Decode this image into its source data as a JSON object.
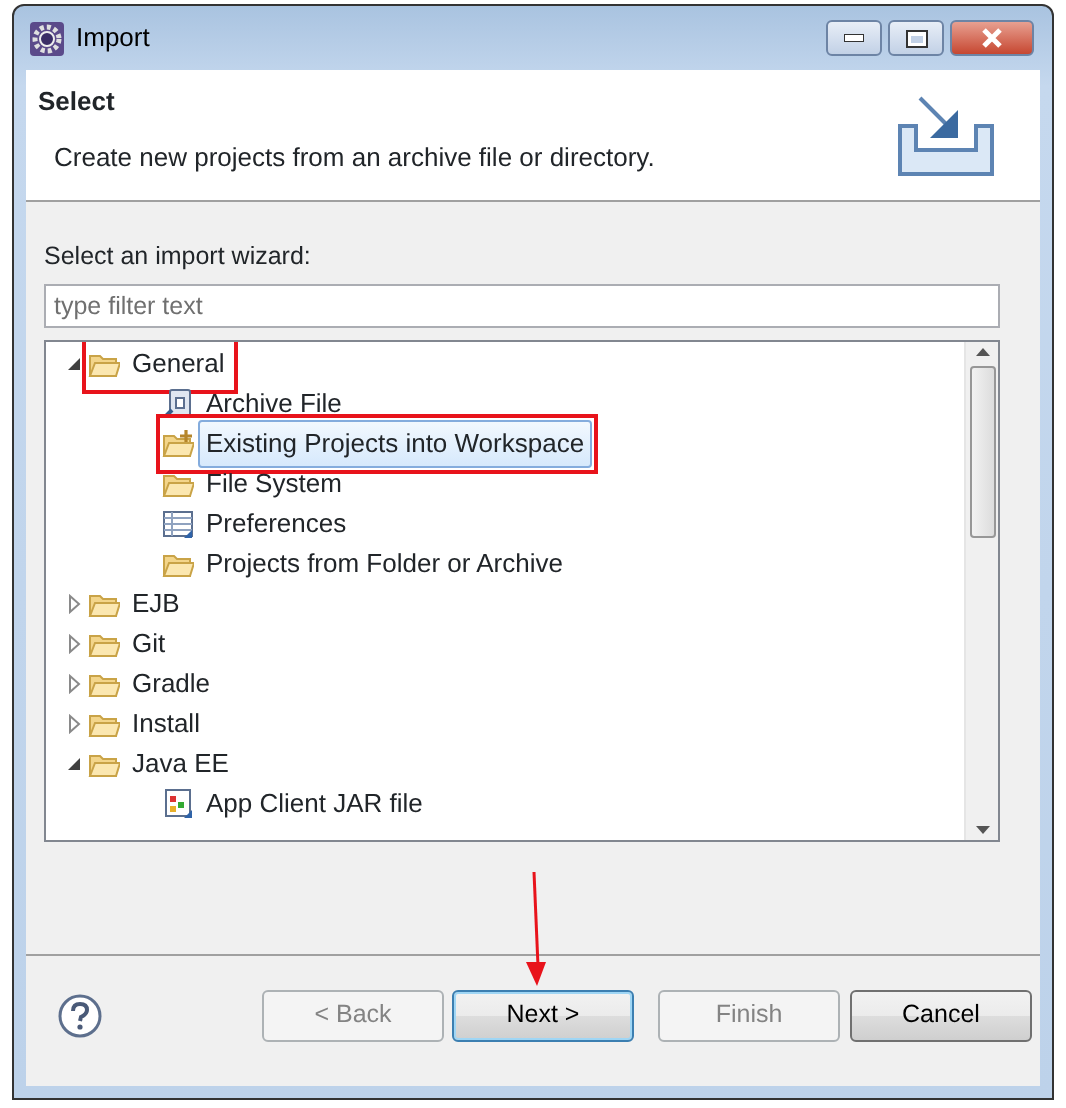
{
  "window": {
    "title": "Import"
  },
  "header": {
    "title": "Select",
    "description": "Create new projects from an archive file or directory."
  },
  "wizard_label": "Select an import wizard:",
  "filter": {
    "placeholder": "type filter text"
  },
  "tree": [
    {
      "label": "General",
      "kind": "folder",
      "expanded": true,
      "selected": false,
      "annotated": true,
      "children": [
        {
          "label": "Archive File",
          "kind": "archive",
          "selected": false
        },
        {
          "label": "Existing Projects into Workspace",
          "kind": "project",
          "selected": true,
          "annotated": true
        },
        {
          "label": "File System",
          "kind": "folder",
          "selected": false
        },
        {
          "label": "Preferences",
          "kind": "table",
          "selected": false
        },
        {
          "label": "Projects from Folder or Archive",
          "kind": "folder",
          "selected": false
        }
      ]
    },
    {
      "label": "EJB",
      "kind": "folder",
      "expanded": false,
      "selected": false
    },
    {
      "label": "Git",
      "kind": "folder",
      "expanded": false,
      "selected": false
    },
    {
      "label": "Gradle",
      "kind": "folder",
      "expanded": false,
      "selected": false
    },
    {
      "label": "Install",
      "kind": "folder",
      "expanded": false,
      "selected": false
    },
    {
      "label": "Java EE",
      "kind": "folder",
      "expanded": true,
      "selected": false,
      "children": [
        {
          "label": "App Client JAR file",
          "kind": "jar",
          "selected": false
        }
      ]
    }
  ],
  "buttons": [
    {
      "label": "< Back",
      "disabled": true,
      "default": false
    },
    {
      "label": "Next >",
      "disabled": false,
      "default": true,
      "pointed": true
    },
    {
      "label": "Finish",
      "disabled": true,
      "default": false
    },
    {
      "label": "Cancel",
      "disabled": false,
      "default": false
    }
  ]
}
